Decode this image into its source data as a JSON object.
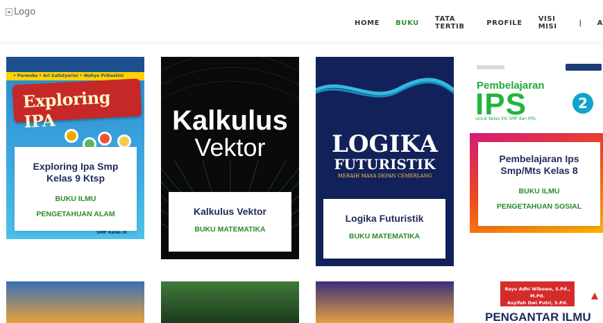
{
  "header": {
    "logo_alt": "Logo",
    "nav": [
      {
        "label": "HOME",
        "active": false
      },
      {
        "label": "BUKU",
        "active": true
      },
      {
        "label": "TATA TERTIB",
        "active": false
      },
      {
        "label": "PROFILE",
        "active": false
      },
      {
        "label": "VISI MISI",
        "active": false
      }
    ],
    "separator": "|",
    "truncated_item": "A"
  },
  "books": [
    {
      "title": "Exploring Ipa Smp Kelas 9 Ktsp",
      "category_lines": [
        "BUKU ILMU",
        "PENGETAHUAN ALAM"
      ],
      "cover": {
        "title": "Exploring IPA",
        "authors": "• Purwoko • Ari Sulistyorini • Wahyu Prihastini",
        "footer": "SMP Kelas IX"
      }
    },
    {
      "title": "Kalkulus Vektor",
      "category_lines": [
        "BUKU MATEMATIKA"
      ],
      "cover": {
        "line1": "Kalkulus",
        "line2": "Vektor"
      }
    },
    {
      "title": "Logika Futuristik",
      "category_lines": [
        "BUKU MATEMATIKA"
      ],
      "cover": {
        "line1": "LOGIKA",
        "line2": "FUTURISTIK",
        "tagline": "MERAIH MASA DEPAN CEMERLANG"
      }
    },
    {
      "title": "Pembelajaran Ips Smp/Mts Kelas 8",
      "category_lines": [
        "BUKU ILMU",
        "PENGETAHUAN SOSIAL"
      ],
      "cover": {
        "line1": "Pembelajaran",
        "line2": "IPS",
        "number": "2",
        "subtitle": "untuk Kelas VIII SMP dan MTs"
      }
    }
  ],
  "bottom_row": {
    "card4_authors": [
      "Bayu Adhi Wibowo, S.Pd., M.Pd.",
      "Asyifah Dwi Putri, S.Pd."
    ],
    "card4_title_partial": "PENGANTAR ILMU"
  },
  "colors": {
    "accent_green": "#2f8f2f",
    "title_navy": "#1e2a5a"
  }
}
